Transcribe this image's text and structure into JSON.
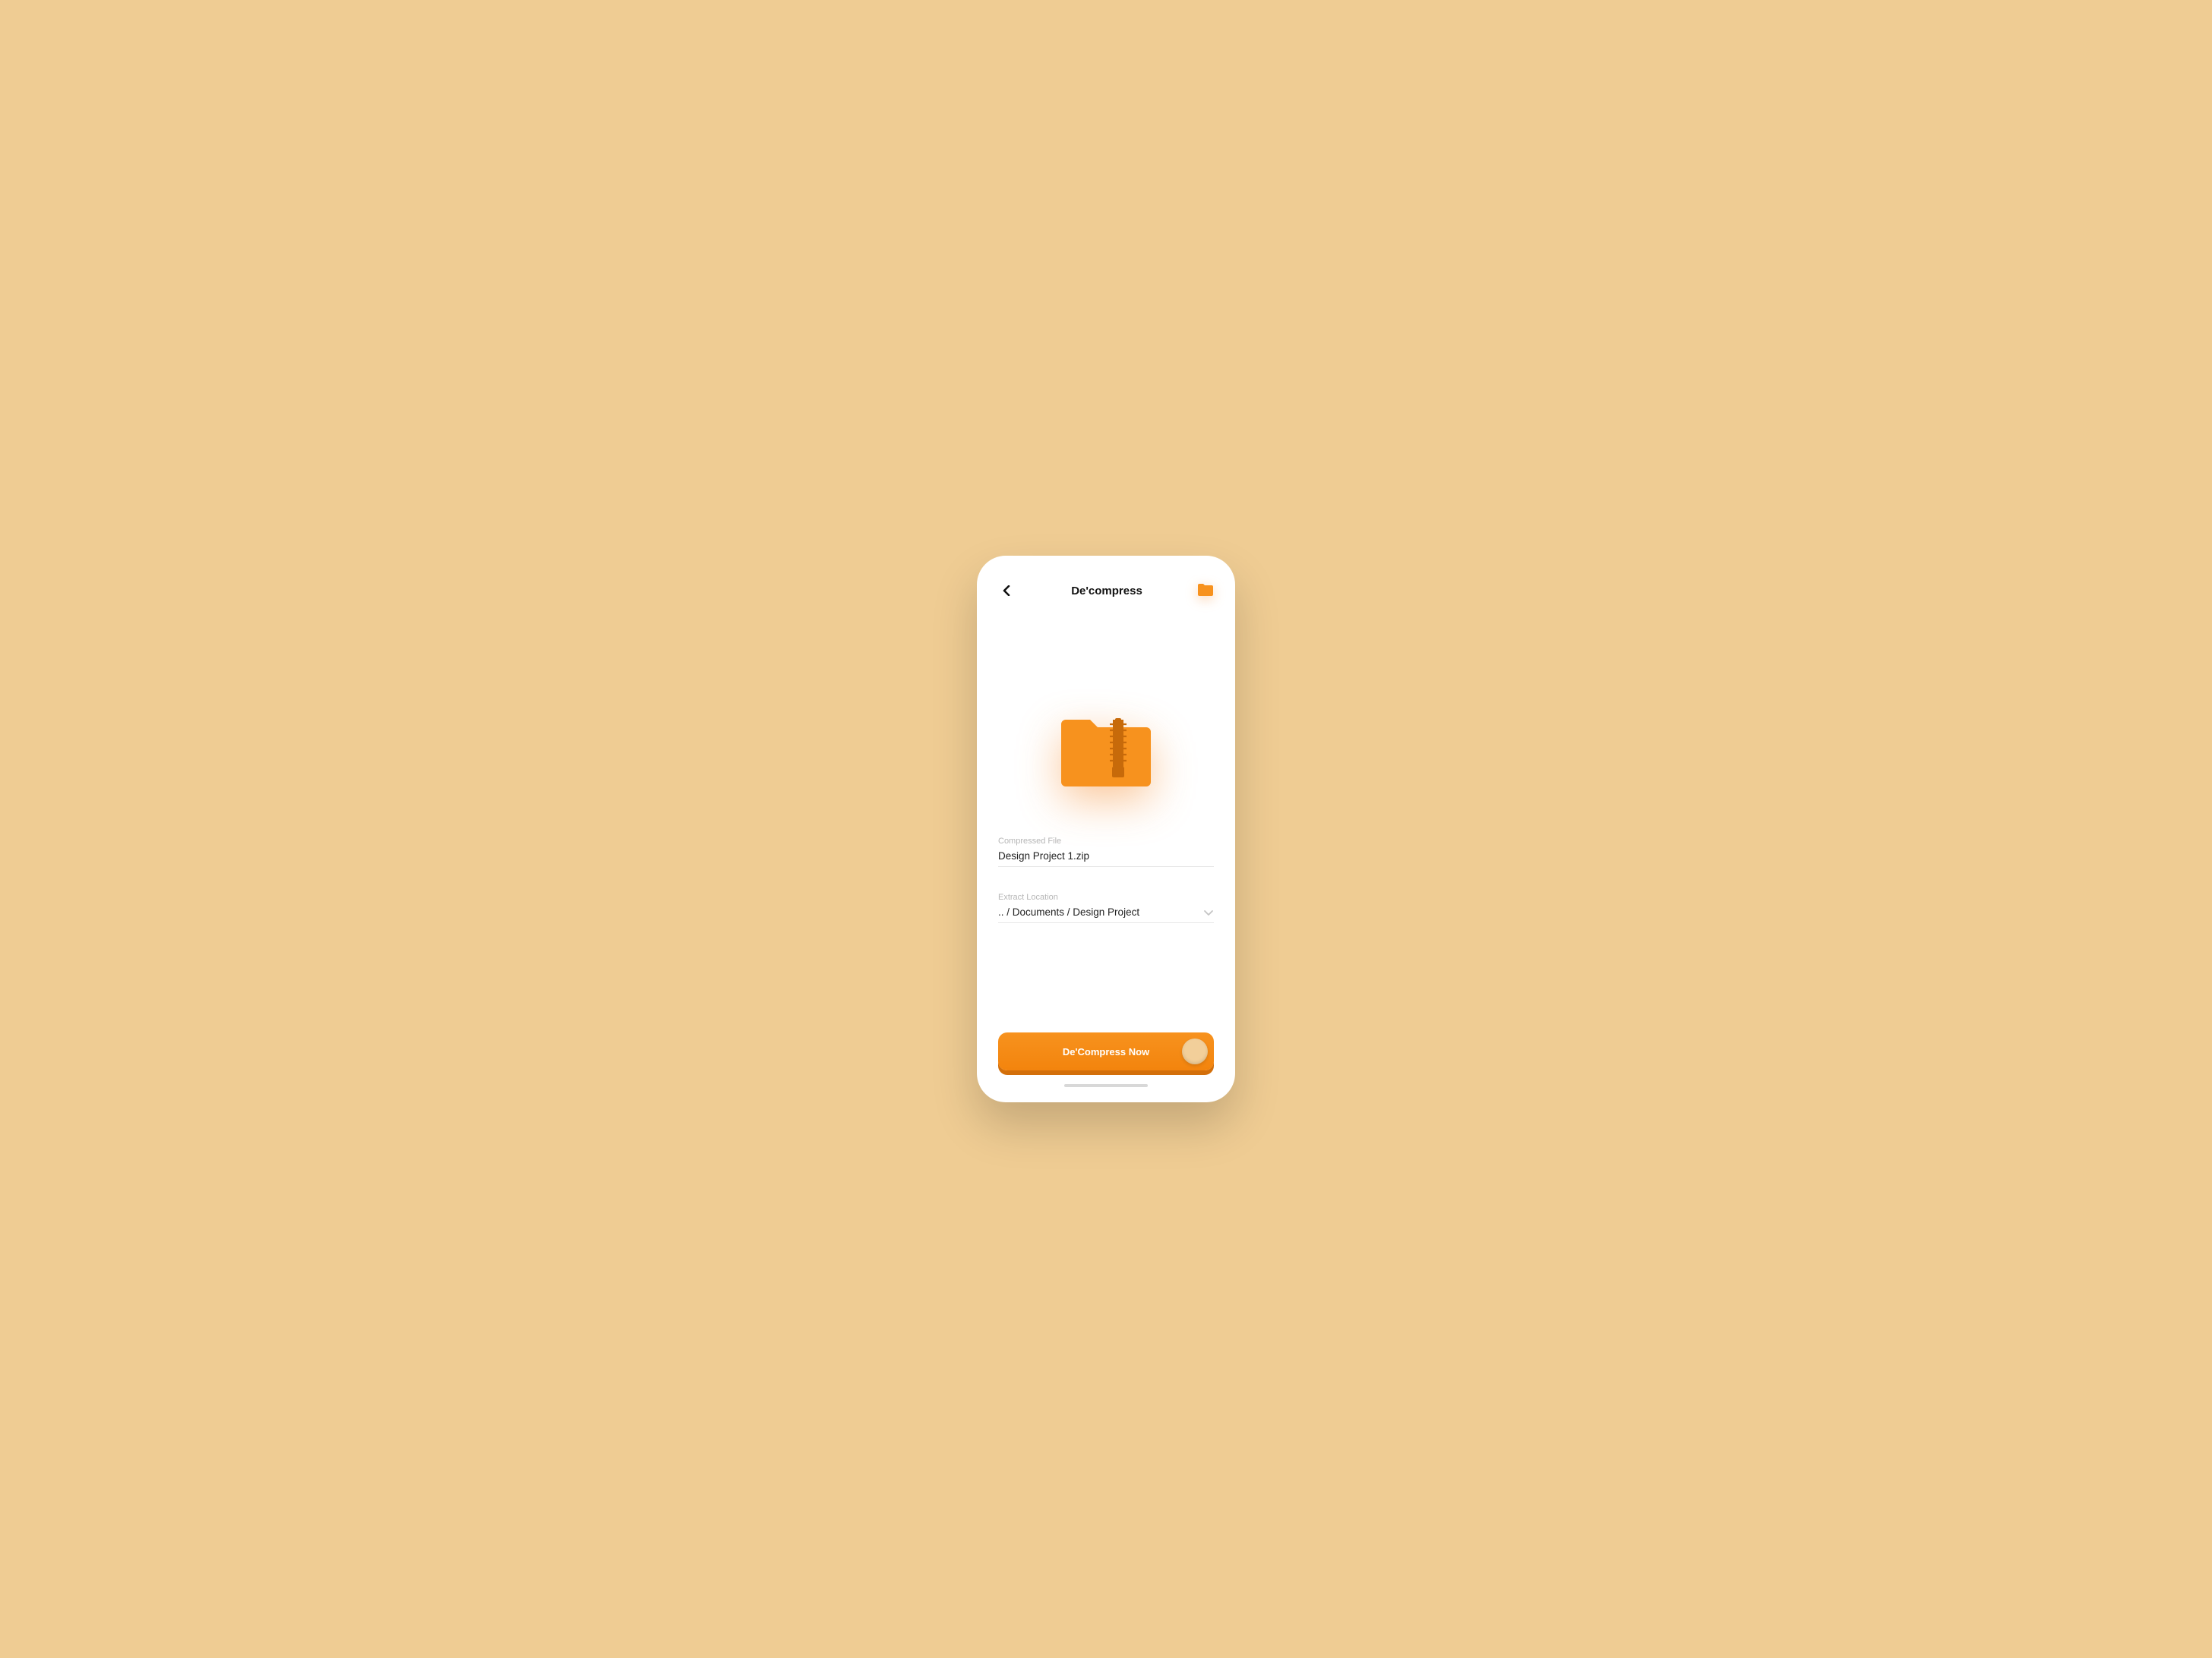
{
  "header": {
    "title": "De'compress"
  },
  "fields": {
    "compressed_label": "Compressed File",
    "compressed_value": "Design Project 1.zip",
    "location_label": "Extract Location",
    "location_value": ".. / Documents / Design Project"
  },
  "cta": {
    "label": "De'Compress Now"
  },
  "colors": {
    "accent": "#f7921e",
    "accent_dark": "#d36f0a",
    "bg": "#efcc93"
  }
}
